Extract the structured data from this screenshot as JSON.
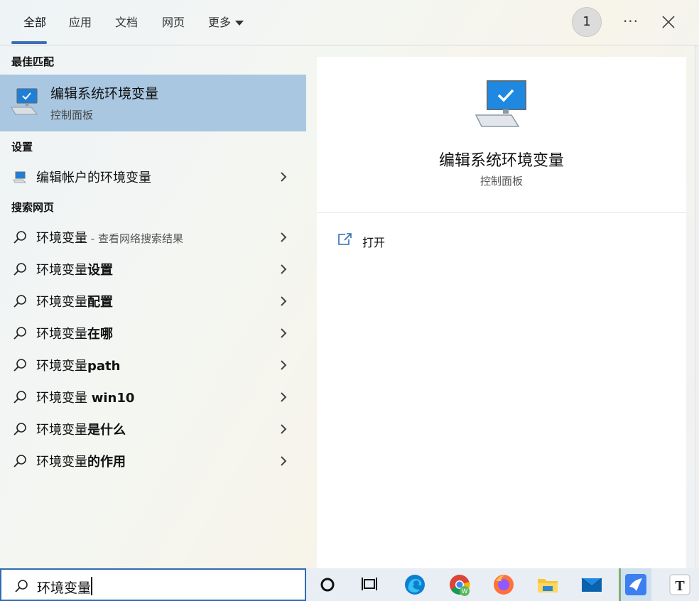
{
  "tabs": [
    {
      "label": "全部",
      "active": true
    },
    {
      "label": "应用"
    },
    {
      "label": "文档"
    },
    {
      "label": "网页"
    },
    {
      "label": "更多"
    }
  ],
  "header": {
    "badge": "1",
    "more": "···"
  },
  "best_match": {
    "heading": "最佳匹配",
    "title": "编辑系统环境变量",
    "subtitle": "控制面板"
  },
  "settings": {
    "heading": "设置",
    "items": [
      {
        "label": "编辑帐户的环境变量"
      }
    ]
  },
  "web": {
    "heading": "搜索网页",
    "first": {
      "query": "环境变量",
      "hint": " - 查看网络搜索结果"
    },
    "items": [
      {
        "prefix": "环境变量",
        "bold": "设置"
      },
      {
        "prefix": "环境变量",
        "bold": "配置"
      },
      {
        "prefix": "环境变量",
        "bold": "在哪"
      },
      {
        "prefix": "环境变量",
        "bold": "path"
      },
      {
        "prefix": "环境变量 ",
        "bold": "win10"
      },
      {
        "prefix": "环境变量",
        "bold": "是什么"
      },
      {
        "prefix": "环境变量",
        "bold": "的作用"
      }
    ]
  },
  "preview": {
    "title": "编辑系统环境变量",
    "subtitle": "控制面板",
    "action_open": "打开"
  },
  "search": {
    "value": "环境变量"
  },
  "taskbar": {
    "icons": [
      "cortana-icon",
      "task-view-icon",
      "edge-icon",
      "chrome-icon",
      "firefox-icon",
      "file-explorer-icon",
      "mail-icon",
      "feishu-icon",
      "typora-icon"
    ]
  },
  "colors": {
    "accent": "#2f6db4",
    "selection": "#a9c7e1"
  }
}
